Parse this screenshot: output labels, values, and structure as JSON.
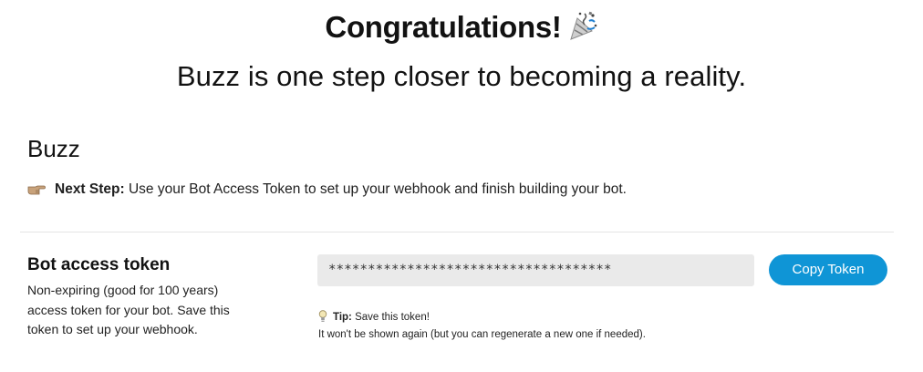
{
  "hero": {
    "title": "Congratulations!",
    "title_icon": "party-popper-icon",
    "subtitle": "Buzz is one step closer to becoming a reality."
  },
  "bot": {
    "name": "Buzz"
  },
  "next_step": {
    "icon": "pointing-hand-icon",
    "label": "Next Step:",
    "text": "Use your Bot Access Token to set up your webhook and finish building your bot."
  },
  "token_section": {
    "heading": "Bot access token",
    "description": "Non-expiring (good for 100 years) access token for your bot. Save this token to set up your webhook.",
    "token_masked": "************************************",
    "copy_button_label": "Copy Token",
    "tip_icon": "lightbulb-icon",
    "tip_label": "Tip:",
    "tip_text": "Save this token!",
    "tip_note": "It won't be shown again (but you can regenerate a new one if needed)."
  },
  "colors": {
    "accent": "#0f95d6",
    "field_background": "#eaeaea",
    "divider": "#e4e4e4",
    "text": "#121212"
  }
}
